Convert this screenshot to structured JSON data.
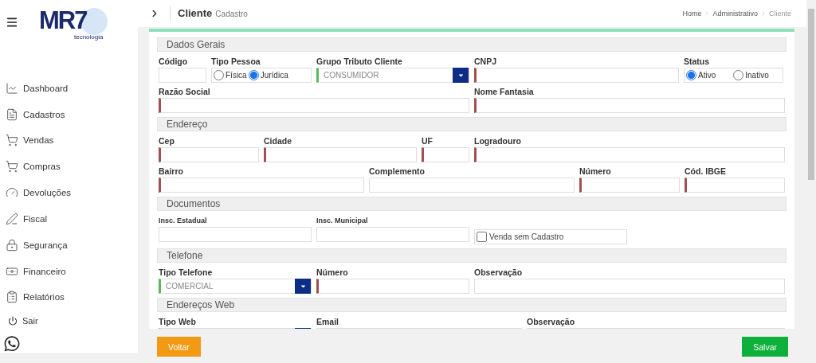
{
  "logo": {
    "name": "MR7",
    "tagline": "tecnologia"
  },
  "sidebar": {
    "items": [
      {
        "label": "Dashboard",
        "kind": "chart"
      },
      {
        "label": "Cadastros",
        "kind": "doc"
      },
      {
        "label": "Vendas",
        "kind": "cart"
      },
      {
        "label": "Compras",
        "kind": "cart"
      },
      {
        "label": "Devoluções",
        "kind": "gauge"
      },
      {
        "label": "Fiscal",
        "kind": "pen"
      },
      {
        "label": "Segurança",
        "kind": "lock"
      },
      {
        "label": "Financeiro",
        "kind": "money"
      },
      {
        "label": "Relatórios",
        "kind": "report"
      },
      {
        "label": "Sair",
        "kind": "power"
      }
    ]
  },
  "header": {
    "title": "Cliente",
    "subtitle": "Cadastro",
    "breadcrumb": [
      "Home",
      "Administrativo",
      "Cliente"
    ]
  },
  "sections": [
    {
      "title": "Dados Gerais",
      "rows": [
        {
          "fields": [
            {
              "label": "Código",
              "kind": "text",
              "required": false
            },
            {
              "label": "Tipo Pessoa",
              "kind": "radio",
              "options": [
                {
                  "label": "Física",
                  "selected": false
                },
                {
                  "label": "Jurídica",
                  "selected": true
                }
              ]
            },
            {
              "label": "Grupo Tributo Cliente",
              "kind": "select",
              "value": "CONSUMIDOR"
            },
            {
              "label": "CNPJ",
              "kind": "text",
              "required": true
            },
            {
              "label": "Status",
              "kind": "radio",
              "options": [
                {
                  "label": "Ativo",
                  "selected": true
                },
                {
                  "label": "Inativo",
                  "selected": false
                }
              ]
            }
          ]
        },
        {
          "fields": [
            {
              "label": "Razão Social",
              "kind": "text",
              "required": true
            },
            {
              "label": "Nome Fantasia",
              "kind": "text",
              "required": true
            }
          ]
        }
      ]
    },
    {
      "title": "Endereço",
      "rows": [
        {
          "fields": [
            {
              "label": "Cep",
              "kind": "text",
              "required": true
            },
            {
              "label": "Cidade",
              "kind": "text",
              "required": true
            },
            {
              "label": "UF",
              "kind": "text",
              "required": true
            },
            {
              "label": "Logradouro",
              "kind": "text",
              "required": true
            }
          ]
        },
        {
          "fields": [
            {
              "label": "Bairro",
              "kind": "text",
              "required": true
            },
            {
              "label": "Complemento",
              "kind": "text",
              "required": false
            },
            {
              "label": "Número",
              "kind": "text",
              "required": true
            },
            {
              "label": "Cód. IBGE",
              "kind": "text",
              "required": true
            }
          ]
        }
      ]
    },
    {
      "title": "Documentos",
      "rows": [
        {
          "fields": [
            {
              "label": "Insc. Estadual",
              "kind": "text",
              "required": false,
              "small": true
            },
            {
              "label": "Insc. Municipal",
              "kind": "text",
              "required": false,
              "small": true
            },
            {
              "label": "Venda sem Cadastro",
              "kind": "checkbox",
              "checked": false
            }
          ]
        }
      ]
    },
    {
      "title": "Telefone",
      "rows": [
        {
          "fields": [
            {
              "label": "Tipo Telefone",
              "kind": "select",
              "value": "COMERCIAL"
            },
            {
              "label": "Número",
              "kind": "text",
              "required": true
            },
            {
              "label": "Observação",
              "kind": "text",
              "required": false
            }
          ]
        }
      ]
    },
    {
      "title": "Endereços Web",
      "rows": [
        {
          "fields": [
            {
              "label": "Tipo Web",
              "kind": "select"
            },
            {
              "label": "Email",
              "kind": "text",
              "required": false
            },
            {
              "label": "Observação",
              "kind": "text",
              "required": false
            }
          ]
        }
      ]
    }
  ],
  "buttons": [
    {
      "label": "Voltar",
      "kind": "back"
    },
    {
      "label": "Salvar",
      "kind": "save"
    }
  ]
}
